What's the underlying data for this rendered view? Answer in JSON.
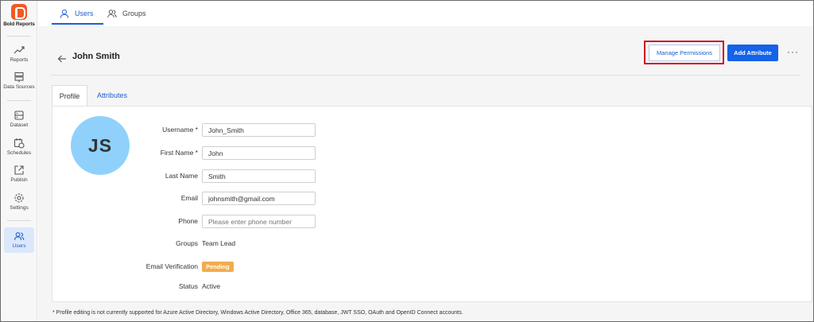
{
  "brand": {
    "name": "Bold Reports",
    "color": "#f05a22"
  },
  "sidebar": {
    "items": [
      {
        "label": "Reports",
        "icon": "trend-icon"
      },
      {
        "label": "Data Sources",
        "icon": "database-icon"
      },
      {
        "label": "Dataset",
        "icon": "dataset-icon"
      },
      {
        "label": "Schedules",
        "icon": "calendar-clock-icon"
      },
      {
        "label": "Publish",
        "icon": "publish-icon"
      },
      {
        "label": "Settings",
        "icon": "gear-icon"
      },
      {
        "label": "Users",
        "icon": "users-icon",
        "active": true
      }
    ]
  },
  "top_tabs": [
    {
      "label": "Users",
      "icon": "user-icon",
      "active": true
    },
    {
      "label": "Groups",
      "icon": "group-icon",
      "active": false
    }
  ],
  "header": {
    "title": "John Smith",
    "manage_permissions_label": "Manage Permissions",
    "add_attribute_label": "Add Attribute",
    "more_label": "···"
  },
  "profile_tabs": [
    {
      "label": "Profile",
      "active": true
    },
    {
      "label": "Attributes",
      "active": false
    }
  ],
  "profile": {
    "initials": "JS",
    "avatar_color": "#8fd1fb",
    "fields": {
      "username": {
        "label": "Username *",
        "value": "John_Smith"
      },
      "first_name": {
        "label": "First Name *",
        "value": "John"
      },
      "last_name": {
        "label": "Last Name",
        "value": "Smith"
      },
      "email": {
        "label": "Email",
        "value": "johnsmith@gmail.com"
      },
      "phone": {
        "label": "Phone",
        "value": "",
        "placeholder": "Please enter phone number"
      },
      "groups": {
        "label": "Groups",
        "value": "Team Lead"
      },
      "email_verification": {
        "label": "Email Verification",
        "value": "Pending",
        "color": "#f0ad4e"
      },
      "status": {
        "label": "Status",
        "value": "Active"
      }
    }
  },
  "footnote": "* Profile editing is not currently supported for Azure Active Directory, Windows Active Directory, Office 365, database, JWT SSO, OAuth and OpenID Connect accounts.",
  "colors": {
    "accent": "#1463e8",
    "highlight": "#d01421"
  }
}
